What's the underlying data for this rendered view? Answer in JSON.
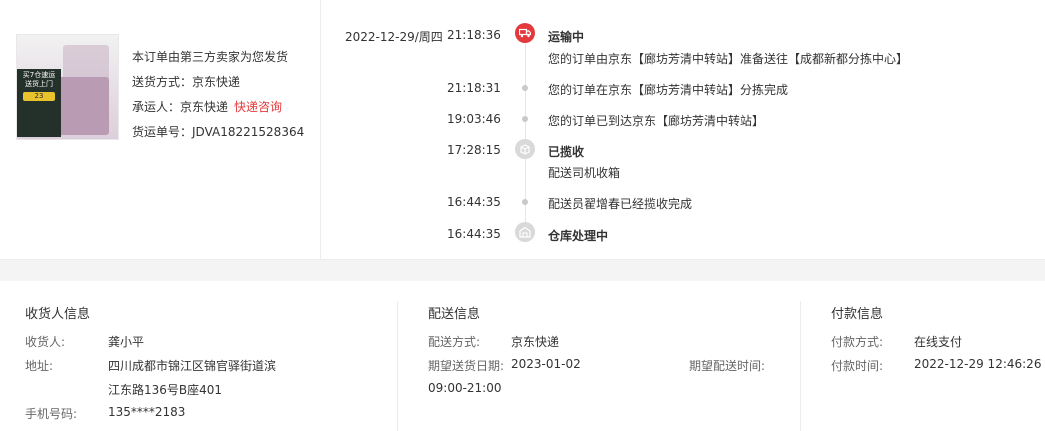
{
  "order": {
    "note": "本订单由第三方卖家为您发货",
    "delivery_method_label": "送货方式：",
    "delivery_method": "京东快递",
    "carrier_label": "承运人：",
    "carrier": "京东快递",
    "carrier_link": "快递咨询",
    "waybill_label": "货运单号：",
    "waybill": "JDVA18221528364",
    "thumb_text_1": "买7仓速运",
    "thumb_text_2": "送货上门",
    "thumb_badge": "23"
  },
  "tracking": {
    "date": "2022-12-29/周四",
    "events": [
      {
        "time": "21:18:36",
        "status": "运输中",
        "msg": "您的订单由京东【廊坊芳清中转站】准备送往【成都新都分拣中心】",
        "icon": "truck-icon"
      },
      {
        "time": "21:18:31",
        "msg": "您的订单在京东【廊坊芳清中转站】分拣完成"
      },
      {
        "time": "19:03:46",
        "msg": "您的订单已到达京东【廊坊芳清中转站】"
      },
      {
        "time": "17:28:15",
        "status": "已揽收",
        "msg": "配送司机收箱",
        "icon": "package-icon"
      },
      {
        "time": "16:44:35",
        "msg": "配送员翟增春已经揽收完成"
      },
      {
        "time": "16:44:35",
        "status": "仓库处理中",
        "icon": "warehouse-icon"
      }
    ]
  },
  "receiver": {
    "title": "收货人信息",
    "name_label": "收货人:",
    "name": "龚小平",
    "address_label": "地址:",
    "address_line1": "四川成都市锦江区锦官驿街道滨",
    "address_line2": "江东路136号B座401",
    "phone_label": "手机号码:",
    "phone": "135****2183"
  },
  "shipping": {
    "title": "配送信息",
    "method_label": "配送方式:",
    "method": "京东快递",
    "expected_date_label": "期望送货日期:",
    "expected_date": "2023-01-02",
    "expected_time_label": "期望配送时间:",
    "expected_time": "09:00-21:00"
  },
  "payment": {
    "title": "付款信息",
    "method_label": "付款方式:",
    "method": "在线支付",
    "time_label": "付款时间:",
    "time": "2022-12-29 12:46:26"
  },
  "colors": {
    "accent": "#e4393c"
  }
}
